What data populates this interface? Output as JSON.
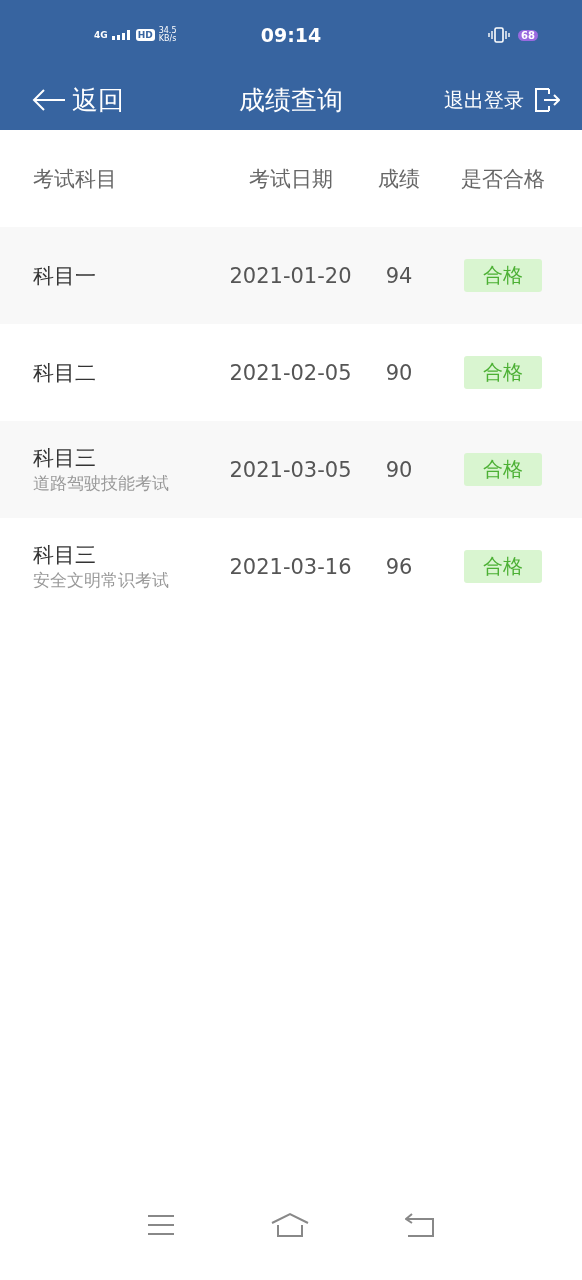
{
  "status_bar": {
    "network": "4G",
    "hd": "HD",
    "speed": "34.5",
    "speed_unit": "KB/s",
    "time": "09:14",
    "battery": "68"
  },
  "nav": {
    "back": "返回",
    "title": "成绩查询",
    "logout": "退出登录"
  },
  "table": {
    "columns": [
      "考试科目",
      "考试日期",
      "成绩",
      "是否合格"
    ],
    "rows": [
      {
        "subject": "科目一",
        "date": "2021-01-20",
        "score": "94",
        "result": "合格",
        "passed": true
      },
      {
        "subject": "科目二",
        "date": "2021-02-05",
        "score": "90",
        "result": "合格",
        "passed": true
      },
      {
        "subject": "科目三",
        "note": "道路驾驶技能考试",
        "date": "2021-03-05",
        "score": "90",
        "result": "合格",
        "passed": true
      },
      {
        "subject": "科目三",
        "note": "安全文明常识考试",
        "date": "2021-03-16",
        "score": "96",
        "result": "合格",
        "passed": true
      }
    ]
  }
}
